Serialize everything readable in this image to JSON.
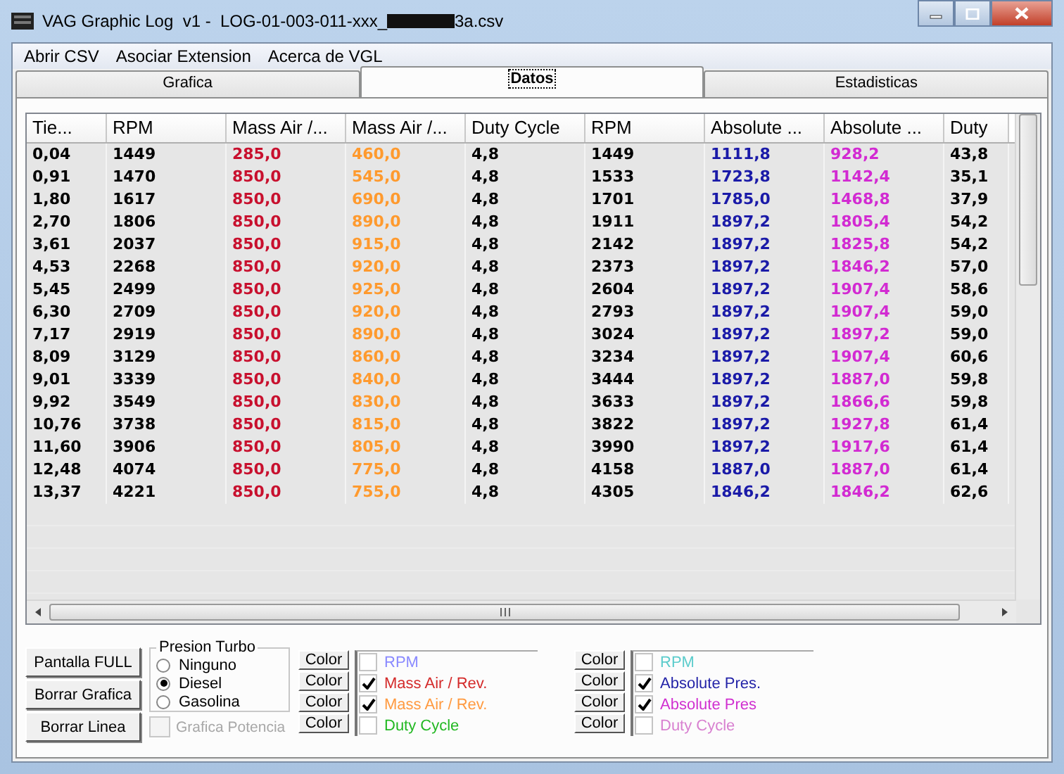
{
  "window": {
    "title_before": "VAG Graphic Log  v1 -  LOG-01-003-011-xxx_",
    "title_after": "3a.csv"
  },
  "menu": [
    "Abrir CSV",
    "Asociar Extension",
    "Acerca de VGL"
  ],
  "tabs": [
    {
      "label": "Grafica",
      "selected": false
    },
    {
      "label": "Datos",
      "selected": true
    },
    {
      "label": "Estadisticas",
      "selected": false
    }
  ],
  "table": {
    "columns": [
      {
        "label": "Tie..."
      },
      {
        "label": "RPM"
      },
      {
        "label": "Mass Air /...",
        "color": "#c8102e"
      },
      {
        "label": "Mass Air /...",
        "color": "#ff9a2e"
      },
      {
        "label": "Duty Cycle"
      },
      {
        "label": "RPM"
      },
      {
        "label": "Absolute ...",
        "color": "#1a1aa8"
      },
      {
        "label": "Absolute ...",
        "color": "#d22ad2"
      },
      {
        "label": "Duty"
      }
    ],
    "rows": [
      [
        "0,04",
        "1449",
        "285,0",
        "460,0",
        "4,8",
        "1449",
        "1111,8",
        "928,2",
        "43,8"
      ],
      [
        "0,91",
        "1470",
        "850,0",
        "545,0",
        "4,8",
        "1533",
        "1723,8",
        "1142,4",
        "35,1"
      ],
      [
        "1,80",
        "1617",
        "850,0",
        "690,0",
        "4,8",
        "1701",
        "1785,0",
        "1468,8",
        "37,9"
      ],
      [
        "2,70",
        "1806",
        "850,0",
        "890,0",
        "4,8",
        "1911",
        "1897,2",
        "1805,4",
        "54,2"
      ],
      [
        "3,61",
        "2037",
        "850,0",
        "915,0",
        "4,8",
        "2142",
        "1897,2",
        "1825,8",
        "54,2"
      ],
      [
        "4,53",
        "2268",
        "850,0",
        "920,0",
        "4,8",
        "2373",
        "1897,2",
        "1846,2",
        "57,0"
      ],
      [
        "5,45",
        "2499",
        "850,0",
        "925,0",
        "4,8",
        "2604",
        "1897,2",
        "1907,4",
        "58,6"
      ],
      [
        "6,30",
        "2709",
        "850,0",
        "920,0",
        "4,8",
        "2793",
        "1897,2",
        "1907,4",
        "59,0"
      ],
      [
        "7,17",
        "2919",
        "850,0",
        "890,0",
        "4,8",
        "3024",
        "1897,2",
        "1897,2",
        "59,0"
      ],
      [
        "8,09",
        "3129",
        "850,0",
        "860,0",
        "4,8",
        "3234",
        "1897,2",
        "1907,4",
        "60,6"
      ],
      [
        "9,01",
        "3339",
        "850,0",
        "840,0",
        "4,8",
        "3444",
        "1897,2",
        "1887,0",
        "59,8"
      ],
      [
        "9,92",
        "3549",
        "850,0",
        "830,0",
        "4,8",
        "3633",
        "1897,2",
        "1866,6",
        "59,8"
      ],
      [
        "10,76",
        "3738",
        "850,0",
        "815,0",
        "4,8",
        "3822",
        "1897,2",
        "1927,8",
        "61,4"
      ],
      [
        "11,60",
        "3906",
        "850,0",
        "805,0",
        "4,8",
        "3990",
        "1897,2",
        "1917,6",
        "61,4"
      ],
      [
        "12,48",
        "4074",
        "850,0",
        "775,0",
        "4,8",
        "4158",
        "1887,0",
        "1887,0",
        "61,4"
      ],
      [
        "13,37",
        "4221",
        "850,0",
        "755,0",
        "4,8",
        "4305",
        "1846,2",
        "1846,2",
        "62,6"
      ]
    ]
  },
  "buttons": [
    "Pantalla  FULL",
    "Borrar Grafica",
    "Borrar Linea"
  ],
  "presion_turbo": {
    "title": "Presion Turbo",
    "options": [
      {
        "label": "Ninguno",
        "selected": false
      },
      {
        "label": "Diesel",
        "selected": true
      },
      {
        "label": "Gasolina",
        "selected": false
      }
    ]
  },
  "grafica_potencia": {
    "label": "Grafica Potencia",
    "checked": false,
    "disabled": true
  },
  "series_groups": [
    {
      "items": [
        {
          "color_button": "Color",
          "label": "RPM",
          "color": "#8a8aff",
          "checked": false
        },
        {
          "color_button": "Color",
          "label": "Mass Air / Rev.",
          "color": "#d42a2a",
          "checked": true
        },
        {
          "color_button": "Color",
          "label": "Mass Air / Rev.",
          "color": "#ff9a40",
          "checked": true
        },
        {
          "color_button": "Color",
          "label": "Duty Cycle",
          "color": "#22b822",
          "checked": false
        }
      ]
    },
    {
      "items": [
        {
          "color_button": "Color",
          "label": "RPM",
          "color": "#5ccccc",
          "checked": false
        },
        {
          "color_button": "Color",
          "label": "Absolute Pres.",
          "color": "#2424a8",
          "checked": true
        },
        {
          "color_button": "Color",
          "label": "Absolute Pres",
          "color": "#d030d0",
          "checked": true
        },
        {
          "color_button": "Color",
          "label": "Duty Cycle",
          "color": "#d880d0",
          "checked": false
        }
      ]
    }
  ]
}
